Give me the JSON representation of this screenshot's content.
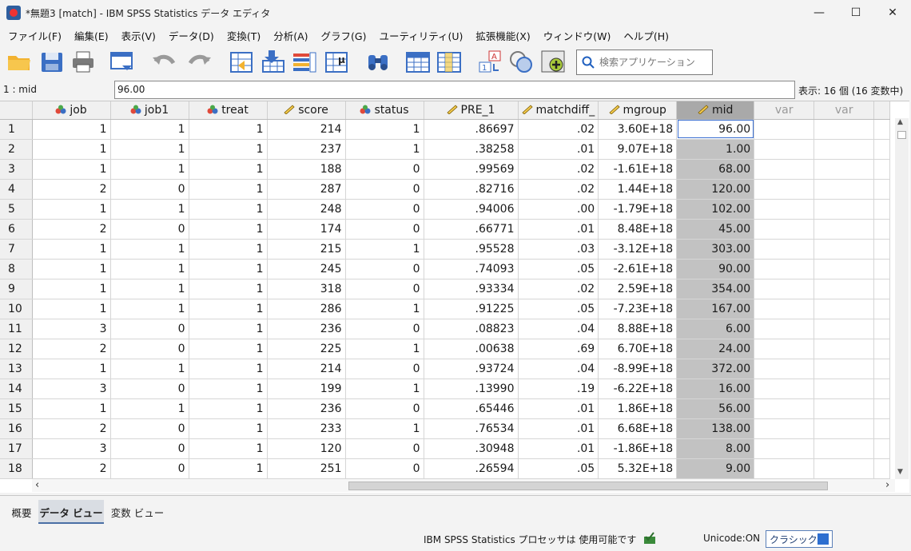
{
  "window": {
    "title": "*無題3 [match] - IBM SPSS Statistics データ エディタ",
    "minimize": "—",
    "maximize": "☐",
    "close": "✕"
  },
  "menu": [
    "ファイル(F)",
    "編集(E)",
    "表示(V)",
    "データ(D)",
    "変換(T)",
    "分析(A)",
    "グラフ(G)",
    "ユーティリティ(U)",
    "拡張機能(X)",
    "ウィンドウ(W)",
    "ヘルプ(H)"
  ],
  "search": {
    "placeholder": "検索アプリケーション"
  },
  "cellbar": {
    "ref": "1 : mid",
    "value": "96.00",
    "display_info": "表示: 16 個 (16 変数中)"
  },
  "columns": [
    {
      "name": "job",
      "icon": "nominal-icon"
    },
    {
      "name": "job1",
      "icon": "nominal-icon"
    },
    {
      "name": "treat",
      "icon": "nominal-icon"
    },
    {
      "name": "score",
      "icon": "scale-icon"
    },
    {
      "name": "status",
      "icon": "nominal-icon"
    },
    {
      "name": "PRE_1",
      "icon": "scale-icon"
    },
    {
      "name": "matchdiff_",
      "icon": "scale-icon"
    },
    {
      "name": "mgroup",
      "icon": "scale-icon"
    },
    {
      "name": "mid",
      "icon": "scale-icon"
    },
    {
      "name": "var",
      "icon": ""
    },
    {
      "name": "var",
      "icon": ""
    }
  ],
  "rows": [
    [
      "1",
      "1",
      "1",
      "1",
      "214",
      "1",
      ".86697",
      ".02",
      "3.60E+18",
      "96.00"
    ],
    [
      "2",
      "1",
      "1",
      "1",
      "237",
      "1",
      ".38258",
      ".01",
      "9.07E+18",
      "1.00"
    ],
    [
      "3",
      "1",
      "1",
      "1",
      "188",
      "0",
      ".99569",
      ".02",
      "-1.61E+18",
      "68.00"
    ],
    [
      "4",
      "2",
      "0",
      "1",
      "287",
      "0",
      ".82716",
      ".02",
      "1.44E+18",
      "120.00"
    ],
    [
      "5",
      "1",
      "1",
      "1",
      "248",
      "0",
      ".94006",
      ".00",
      "-1.79E+18",
      "102.00"
    ],
    [
      "6",
      "2",
      "0",
      "1",
      "174",
      "0",
      ".66771",
      ".01",
      "8.48E+18",
      "45.00"
    ],
    [
      "7",
      "1",
      "1",
      "1",
      "215",
      "1",
      ".95528",
      ".03",
      "-3.12E+18",
      "303.00"
    ],
    [
      "8",
      "1",
      "1",
      "1",
      "245",
      "0",
      ".74093",
      ".05",
      "-2.61E+18",
      "90.00"
    ],
    [
      "9",
      "1",
      "1",
      "1",
      "318",
      "0",
      ".93334",
      ".02",
      "2.59E+18",
      "354.00"
    ],
    [
      "10",
      "1",
      "1",
      "1",
      "286",
      "1",
      ".91225",
      ".05",
      "-7.23E+18",
      "167.00"
    ],
    [
      "11",
      "3",
      "0",
      "1",
      "236",
      "0",
      ".08823",
      ".04",
      "8.88E+18",
      "6.00"
    ],
    [
      "12",
      "2",
      "0",
      "1",
      "225",
      "1",
      ".00638",
      ".69",
      "6.70E+18",
      "24.00"
    ],
    [
      "13",
      "1",
      "1",
      "1",
      "214",
      "0",
      ".93724",
      ".04",
      "-8.99E+18",
      "372.00"
    ],
    [
      "14",
      "3",
      "0",
      "1",
      "199",
      "1",
      ".13990",
      ".19",
      "-6.22E+18",
      "16.00"
    ],
    [
      "15",
      "1",
      "1",
      "1",
      "236",
      "0",
      ".65446",
      ".01",
      "1.86E+18",
      "56.00"
    ],
    [
      "16",
      "2",
      "0",
      "1",
      "233",
      "1",
      ".76534",
      ".01",
      "6.68E+18",
      "138.00"
    ],
    [
      "17",
      "3",
      "0",
      "1",
      "120",
      "0",
      ".30948",
      ".01",
      "-1.86E+18",
      "8.00"
    ],
    [
      "18",
      "2",
      "0",
      "1",
      "251",
      "0",
      ".26594",
      ".05",
      "5.32E+18",
      "9.00"
    ]
  ],
  "tabs": [
    "概要",
    "データ ビュー",
    "変数 ビュー"
  ],
  "status": {
    "processor": "IBM SPSS Statistics プロセッサは 使用可能です",
    "unicode": "Unicode:ON",
    "classic": "クラシック"
  },
  "colors": {
    "selected_column": "#c2c2c2",
    "selected_header": "#a9a9a9",
    "active_cell_border": "#3b6fd1"
  }
}
